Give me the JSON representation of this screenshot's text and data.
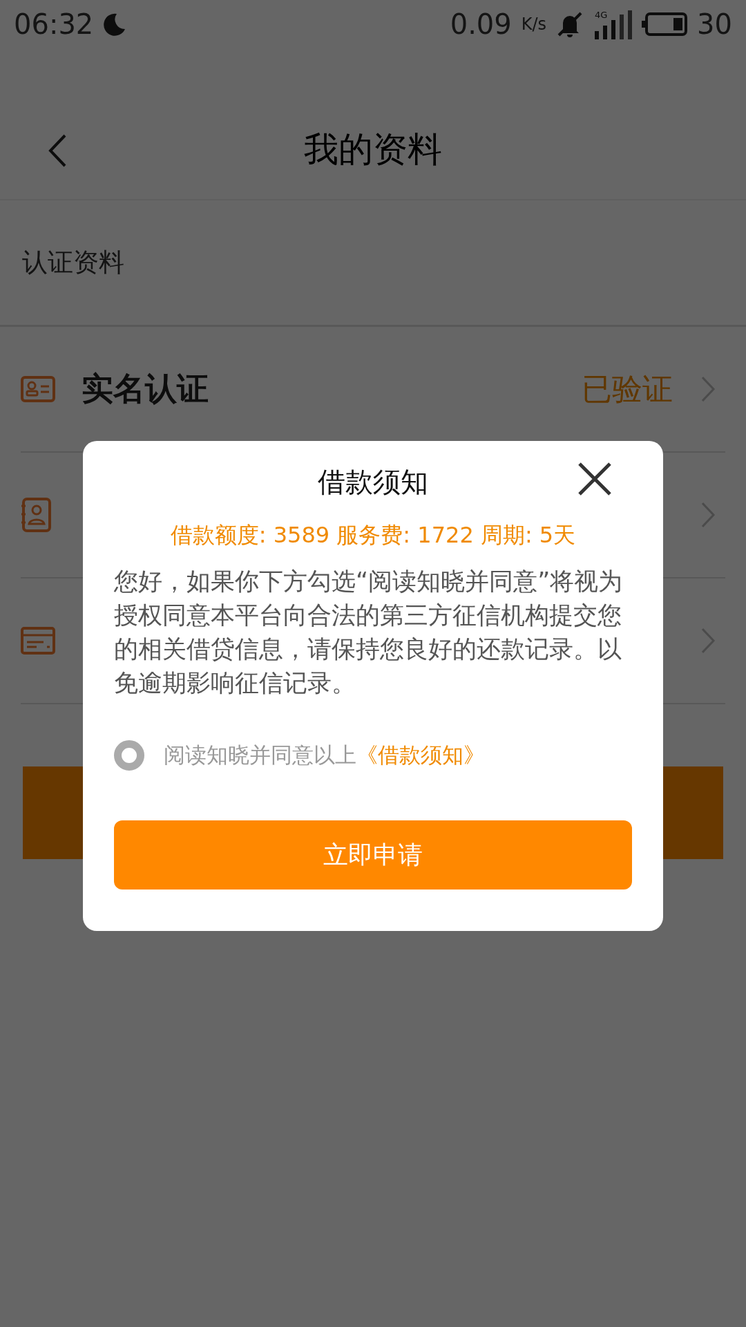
{
  "status_bar": {
    "time": "06:32",
    "speed": "0.09",
    "speed_unit": "K/s",
    "network": "4G",
    "battery_level": "30"
  },
  "header": {
    "title": "我的资料"
  },
  "section": {
    "label": "认证资料"
  },
  "rows": [
    {
      "kind": "id",
      "title": "实名认证",
      "status": "已验证"
    },
    {
      "kind": "contacts"
    },
    {
      "kind": "card"
    }
  ],
  "dialog": {
    "title": "借款须知",
    "summary": "借款额度: 3589  服务费: 1722  周期: 5天",
    "body": "您好，如果你下方勾选“阅读知晓并同意”将视为授权同意本平台向合法的第三方征信机构提交您的相关借贷信息，请保持您良好的还款记录。以免逾期影响征信记录。",
    "agree": {
      "checked": false,
      "text": "阅读知晓并同意以上",
      "link": "《借款须知》"
    },
    "button": "立即申请"
  }
}
